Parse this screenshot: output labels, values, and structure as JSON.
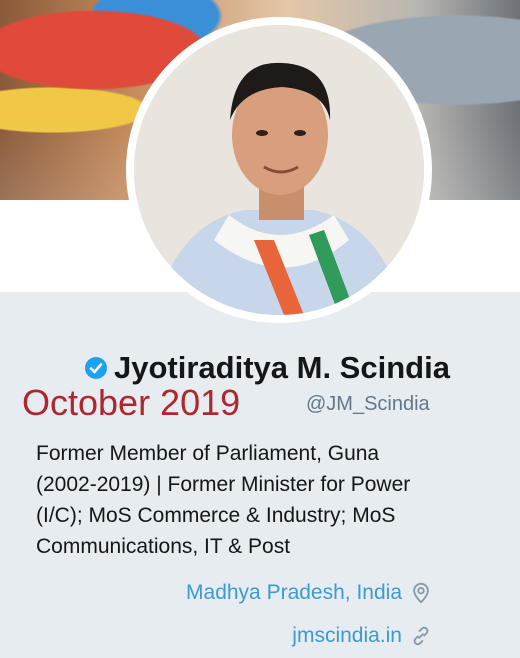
{
  "profile": {
    "display_name": "Jyotiraditya M. Scindia",
    "handle": "@JM_Scindia",
    "verified_icon": "verified-badge-icon",
    "bio_lines": [
      "Former Member of Parliament, Guna",
      "(2002-2019) | Former Minister for Power",
      "(I/C); MoS Commerce & Industry; MoS",
      "Communications, IT & Post"
    ],
    "location": "Madhya Pradesh, India",
    "location_icon": "location-pin-icon",
    "website": "jmscindia.in",
    "website_icon": "link-icon"
  },
  "overlay": {
    "date_caption": "October 2019"
  },
  "colors": {
    "accent": "#3d9ad1",
    "name": "#14171a",
    "secondary": "#657786",
    "caption": "#b0262e",
    "background": "#e6ecf0"
  }
}
